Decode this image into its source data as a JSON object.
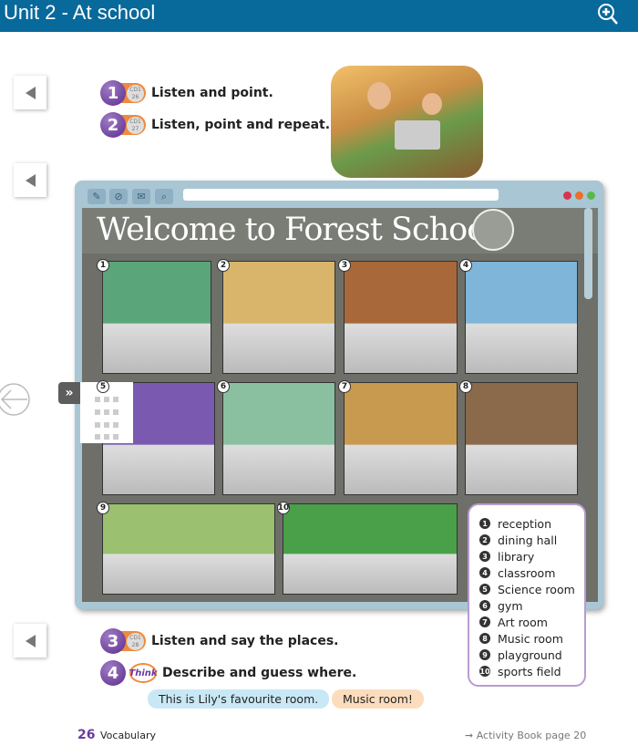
{
  "header": {
    "title": "Unit 2 - At school",
    "zoom_icon": "zoom-in-icon"
  },
  "exercises": [
    {
      "number": "1",
      "cd": "CD1",
      "track": "26",
      "text": "Listen and point."
    },
    {
      "number": "2",
      "cd": "CD1",
      "track": "27",
      "text": "Listen, point and repeat."
    },
    {
      "number": "3",
      "cd": "CD1",
      "track": "28",
      "text": "Listen and say the places."
    },
    {
      "number": "4",
      "badge": "Think",
      "text": "Describe and guess where."
    }
  ],
  "browser": {
    "heading": "Welcome to Forest School"
  },
  "places": [
    {
      "n": "1",
      "label": "reception",
      "color": "#5aa67a"
    },
    {
      "n": "2",
      "label": "dining hall",
      "color": "#d8b56a"
    },
    {
      "n": "3",
      "label": "library",
      "color": "#a8683a"
    },
    {
      "n": "4",
      "label": "classroom",
      "color": "#7fb5d8"
    },
    {
      "n": "5",
      "label": "Science room",
      "color": "#7a5ab0"
    },
    {
      "n": "6",
      "label": "gym",
      "color": "#8ac0a0"
    },
    {
      "n": "7",
      "label": "Art room",
      "color": "#c89a50"
    },
    {
      "n": "8",
      "label": "Music room",
      "color": "#8a6a4a"
    },
    {
      "n": "9",
      "label": "playground",
      "color": "#9ac070"
    },
    {
      "n": "10",
      "label": "sports field",
      "color": "#4aa048"
    }
  ],
  "speech": {
    "left": "This is Lily's favourite room.",
    "right": "Music room!",
    "left_color": "#c9e8f5",
    "right_color": "#fbdcbc"
  },
  "footer": {
    "page": "26",
    "section": "Vocabulary",
    "activity": "➞ Activity Book page 20"
  }
}
